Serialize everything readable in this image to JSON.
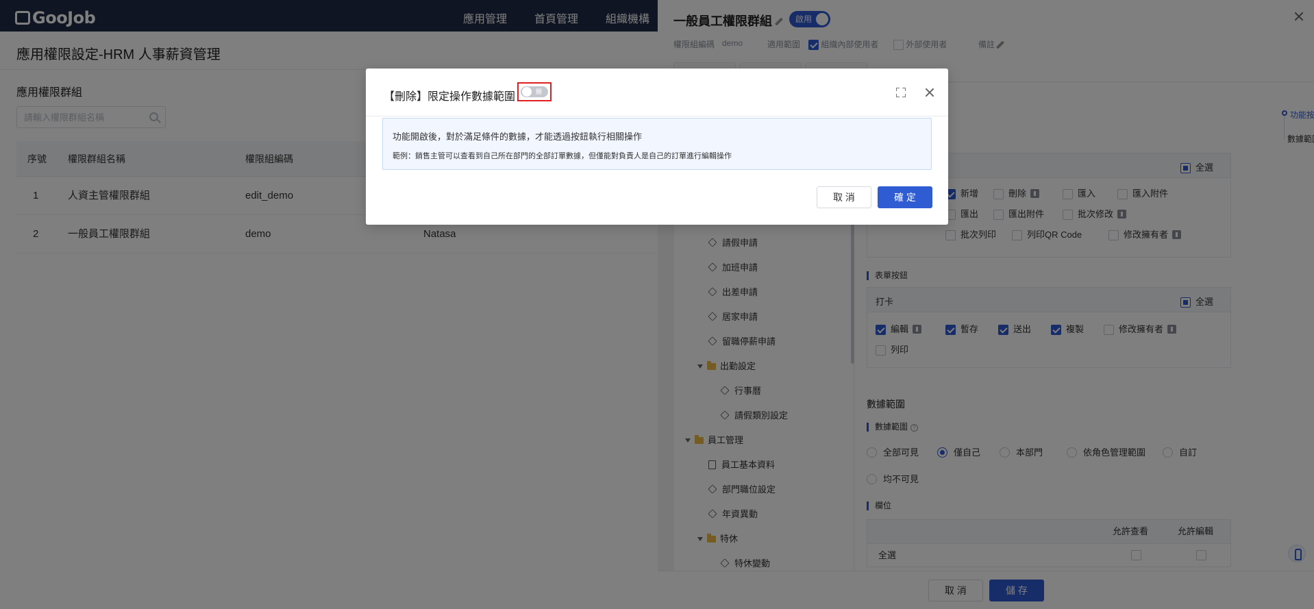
{
  "topbar": {
    "logo": "GooJob",
    "nav": [
      "應用管理",
      "首頁管理",
      "組織機構"
    ]
  },
  "page": {
    "title": "應用權限設定-HRM 人事薪資管理",
    "section_title": "應用權限群組",
    "search_placeholder": "請輸入權限群組名稱",
    "table": {
      "headers": [
        "序號",
        "權限群組名稱",
        "權限組編碼"
      ],
      "rows": [
        {
          "no": "1",
          "name": "人資主管權限群組",
          "code": "edit_demo",
          "extra": ""
        },
        {
          "no": "2",
          "name": "一般員工權限群組",
          "code": "demo",
          "extra": "Natasa"
        }
      ]
    }
  },
  "drawer": {
    "title": "一般員工權限群組",
    "status": "啟用",
    "meta": {
      "code_label": "權限組編碼",
      "code_value": "demo",
      "scope_label": "適用範圍",
      "internal_users": "組織內部使用者",
      "external_users": "外部使用者",
      "remark_label": "備註"
    },
    "tree": [
      {
        "label": "請假申請",
        "icon": "cube-icon"
      },
      {
        "label": "加班申請",
        "icon": "cube-icon"
      },
      {
        "label": "出差申請",
        "icon": "cube-icon"
      },
      {
        "label": "居家申請",
        "icon": "cube-icon"
      },
      {
        "label": "留職停薪申請",
        "icon": "cube-icon"
      },
      {
        "label": "出勤設定",
        "icon": "folder-icon"
      },
      {
        "label": "行事曆",
        "icon": "cube-icon"
      },
      {
        "label": "請假類別設定",
        "icon": "cube-icon"
      },
      {
        "label": "員工管理",
        "icon": "folder-icon"
      },
      {
        "label": "員工基本資料",
        "icon": "doc-icon"
      },
      {
        "label": "部門職位設定",
        "icon": "cube-icon"
      },
      {
        "label": "年資異動",
        "icon": "cube-icon"
      },
      {
        "label": "特休",
        "icon": "folder-icon"
      },
      {
        "label": "特休變動",
        "icon": "cube-icon"
      }
    ],
    "select_all": "全選",
    "list_buttons": [
      {
        "label": "新增",
        "checked": true,
        "lock": false
      },
      {
        "label": "刪除",
        "checked": false,
        "lock": true
      },
      {
        "label": "匯入",
        "checked": false,
        "lock": false
      },
      {
        "label": "匯入附件",
        "checked": false,
        "lock": false
      },
      {
        "label": "匯出",
        "checked": false,
        "lock": false
      },
      {
        "label": "匯出附件",
        "checked": false,
        "lock": false
      },
      {
        "label": "批次修改",
        "checked": false,
        "lock": true
      },
      {
        "label": "批次列印",
        "checked": false,
        "lock": false
      },
      {
        "label": "列印QR Code",
        "checked": false,
        "lock": false
      },
      {
        "label": "修改擁有者",
        "checked": false,
        "lock": true
      }
    ],
    "form_buttons_title": "表單按鈕",
    "form_group_name": "打卡",
    "form_buttons": [
      {
        "label": "編輯",
        "checked": true,
        "lock": true
      },
      {
        "label": "暫存",
        "checked": true,
        "lock": false
      },
      {
        "label": "送出",
        "checked": true,
        "lock": false
      },
      {
        "label": "複製",
        "checked": true,
        "lock": false
      },
      {
        "label": "修改擁有者",
        "checked": false,
        "lock": true
      },
      {
        "label": "列印",
        "checked": false,
        "lock": false
      }
    ],
    "data_scope_title": "數據範圍",
    "data_scope_label": "數據範圍",
    "data_scope_options": [
      "全部可見",
      "僅自己",
      "本部門",
      "依角色管理範圍",
      "自訂",
      "均不可見"
    ],
    "data_scope_selected": "僅自己",
    "fields_title": "欄位",
    "fields_headers": [
      "允許查看",
      "允許編輯"
    ],
    "fields_select_all": "全選",
    "anchor_nav": [
      "功能按鈕",
      "數據範圍"
    ],
    "footer": {
      "cancel": "取 消",
      "save": "儲 存"
    }
  },
  "modal": {
    "title": "【刪除】限定操作數據範圍",
    "switch_label": "關",
    "switch_on": false,
    "info_line1": "功能開啟後，對於滿足條件的數據，才能透過按鈕執行相關操作",
    "info_line2": "範例：銷售主管可以查看到自己所在部門的全部訂單數據，但僅能對負責人是自己的訂單進行編輯操作",
    "cancel": "取 消",
    "confirm": "確 定"
  },
  "colors": {
    "primary": "#2f5bd3",
    "topbar": "#1f2a44",
    "highlight_frame": "#e02020",
    "info_bg": "#f2f7ff"
  }
}
